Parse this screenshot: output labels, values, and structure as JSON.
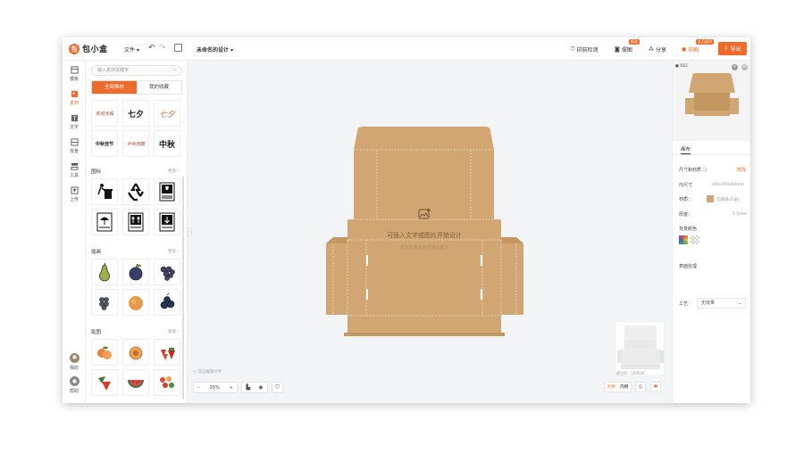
{
  "topbar": {
    "brand": "包小盒",
    "file_menu": "文件",
    "doc_title": "未命名的设计",
    "print_check": "印前检测",
    "gif": "摆图",
    "gif_badge": "新品",
    "share": "分享",
    "print": "印刷",
    "print_badge": "五万起印",
    "export": "导出"
  },
  "rail": {
    "items": [
      {
        "label": "模板"
      },
      {
        "label": "素材"
      },
      {
        "label": "文字"
      },
      {
        "label": "背景"
      },
      {
        "label": "工具"
      },
      {
        "label": "上传"
      }
    ],
    "bottom": [
      {
        "label": "我的"
      },
      {
        "label": "帮助"
      }
    ]
  },
  "panel": {
    "search_placeholder": "输入素材关键字",
    "tabs": [
      {
        "label": "全部素材"
      },
      {
        "label": "我的收藏"
      }
    ],
    "sections": [
      {
        "title": "图标",
        "more": "更多"
      },
      {
        "title": "插画",
        "more": "更多"
      },
      {
        "title": "贴图",
        "more": "更多"
      }
    ],
    "top_thumbs": [
      {
        "text": "欢迎光临"
      },
      {
        "text": "七夕"
      },
      {
        "text": "七夕"
      },
      {
        "text": "中秋佳节"
      },
      {
        "text": "中秋团圆"
      },
      {
        "text": "中秋"
      }
    ]
  },
  "canvas": {
    "hint_main": "可插入文字或图片开始设计",
    "hint_sub": "点击左侧素材可添加图片",
    "bottom_hint": "双击编辑文字",
    "zoom": "25%",
    "view_outer": "外侧",
    "view_inner": "内侧",
    "model_label": "模型ID：100016",
    "colors": {
      "kraft": "#d2a673",
      "kraft_dark": "#c49660",
      "line": "#e8d0ae"
    }
  },
  "rpanel": {
    "tab": "画布",
    "size_label": "尺寸和材质",
    "modify": "修改",
    "inner_size_label": "内尺寸",
    "inner_size_value": "300x200x60mm",
    "material_label": "材质：",
    "material_value": "瓦楞纸(三层)",
    "thickness_label": "厚度：",
    "thickness_value": "1.5mm",
    "bg_color_label": "背景颜色",
    "surface_label": "表面处理",
    "process_label": "工艺",
    "process_value": "无效果"
  },
  "accent": "#f06a2a"
}
